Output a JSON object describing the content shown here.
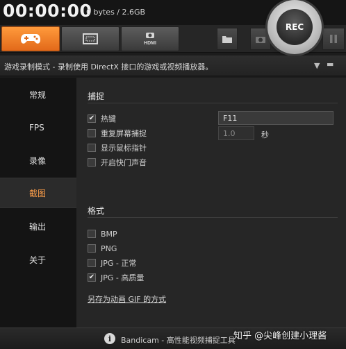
{
  "status": {
    "timer": "00:00:00",
    "size": "0 bytes / 2.6GB"
  },
  "record_button": {
    "label": "REC"
  },
  "tabs": [
    {
      "icon": "gamepad-icon",
      "active": true
    },
    {
      "icon": "screen-rectangle-icon",
      "active": false
    },
    {
      "icon": "hdmi-device-icon",
      "active": false
    }
  ],
  "toolbar": [
    {
      "icon": "folder-icon"
    },
    {
      "icon": "camera-icon"
    },
    {
      "icon": "pause-icon"
    }
  ],
  "mode_bar": {
    "text": "游戏录制模式 - 录制使用 DirectX 接口的游戏或视频播放器。"
  },
  "sidebar": {
    "items": [
      {
        "label": "常规",
        "active": false
      },
      {
        "label": "FPS",
        "active": false
      },
      {
        "label": "录像",
        "active": false
      },
      {
        "label": "截图",
        "active": true
      },
      {
        "label": "输出",
        "active": false
      },
      {
        "label": "关于",
        "active": false
      }
    ]
  },
  "capture": {
    "title": "捕捉",
    "hotkey": {
      "label": "热键",
      "checked": true,
      "value": "F11"
    },
    "repeat": {
      "label": "重复屏幕捕捉",
      "checked": false,
      "value": "1.0",
      "unit": "秒"
    },
    "cursor": {
      "label": "显示鼠标指针",
      "checked": false
    },
    "shutter": {
      "label": "开启快门声音",
      "checked": false
    }
  },
  "format": {
    "title": "格式",
    "options": [
      {
        "label": "BMP",
        "checked": false
      },
      {
        "label": "PNG",
        "checked": false
      },
      {
        "label": "JPG - 正常",
        "checked": false
      },
      {
        "label": "JPG - 高质量",
        "checked": true
      }
    ],
    "gif_link": "另存为动画 GIF 的方式"
  },
  "footer": {
    "text": "Bandicam - 高性能视频捕捉工具",
    "watermark": "知乎 @尖峰创建小理酱"
  },
  "colors": {
    "accent": "#f0821e",
    "active_text": "#ff9f4a",
    "background": "#1c1c1c"
  }
}
